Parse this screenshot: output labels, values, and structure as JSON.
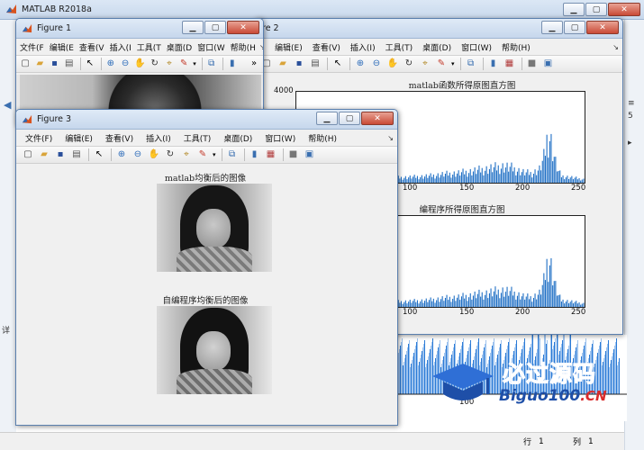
{
  "app": {
    "title": "MATLAB R2018a",
    "bg_color": "#ffffff"
  },
  "status": {
    "row_label": "行",
    "row_value": "1",
    "col_label": "列",
    "col_value": "1"
  },
  "menus": {
    "figure1": [
      "文件(F",
      "编辑(E",
      "查看(V",
      "插入(I",
      "工具(T",
      "桌面(D",
      "窗口(W",
      "帮助(H"
    ],
    "figure2": [
      "编辑(E)",
      "查看(V)",
      "插入(I)",
      "工具(T)",
      "桌面(D)",
      "窗口(W)",
      "帮助(H)"
    ],
    "figure3": [
      "文件(F)",
      "编辑(E)",
      "查看(V)",
      "插入(I)",
      "工具(T)",
      "桌面(D)",
      "窗口(W)",
      "帮助(H)"
    ]
  },
  "figure1": {
    "title": "Figure 1"
  },
  "figure2": {
    "title": "Figure 2",
    "title_fragment": "re 2",
    "plot1_title": "matlab函数所得原图直方图",
    "plot2_title": "编程序所得原图直方图",
    "y_tick": "4000",
    "x_ticks": [
      "100",
      "150",
      "200",
      "250"
    ]
  },
  "figure3": {
    "title": "Figure 3",
    "image1_title": "matlab均衡后的图像",
    "image2_title": "自编程序均衡后的图像"
  },
  "bottom_plot": {
    "x_tick": "100"
  },
  "watermark": {
    "logo_cn": "必过源码",
    "logo_en": "Biguo100",
    "logo_suffix": ".CN",
    "accent": "#2f6fd6",
    "accent_dark": "#1e4fa8"
  },
  "chart_data": [
    {
      "type": "bar",
      "title": "matlab函数所得原图直方图",
      "xlabel": "",
      "ylabel": "",
      "xlim": [
        60,
        256
      ],
      "ylim": [
        0,
        4000
      ],
      "x_ticks": [
        100,
        150,
        200,
        250
      ],
      "series": [
        {
          "values_description": "histogram counts",
          "x": [
            60,
            70,
            80,
            90,
            100,
            110,
            120,
            130,
            140,
            150,
            160,
            170,
            180,
            190,
            200,
            205,
            210,
            215,
            220,
            225,
            228,
            230,
            232,
            234,
            236,
            238,
            240,
            245,
            250,
            255
          ],
          "y": [
            100,
            120,
            140,
            150,
            180,
            200,
            210,
            230,
            260,
            300,
            380,
            430,
            520,
            620,
            720,
            680,
            560,
            450,
            420,
            600,
            1100,
            1900,
            2100,
            1500,
            900,
            500,
            300,
            250,
            200,
            150
          ]
        }
      ]
    },
    {
      "type": "bar",
      "title": "编程序所得原图直方图",
      "xlabel": "",
      "ylabel": "",
      "xlim": [
        60,
        256
      ],
      "ylim": [
        0,
        4000
      ],
      "x_ticks": [
        100,
        150,
        200,
        250
      ],
      "series": [
        {
          "x": [
            60,
            70,
            80,
            90,
            100,
            110,
            120,
            130,
            140,
            150,
            160,
            170,
            180,
            190,
            200,
            205,
            210,
            215,
            220,
            225,
            228,
            230,
            232,
            234,
            236,
            238,
            240,
            245,
            250,
            255
          ],
          "y": [
            100,
            120,
            140,
            150,
            180,
            200,
            210,
            230,
            260,
            300,
            380,
            430,
            520,
            620,
            720,
            680,
            560,
            450,
            420,
            600,
            1100,
            1900,
            2100,
            1500,
            900,
            500,
            300,
            250,
            200,
            150
          ]
        }
      ]
    }
  ]
}
